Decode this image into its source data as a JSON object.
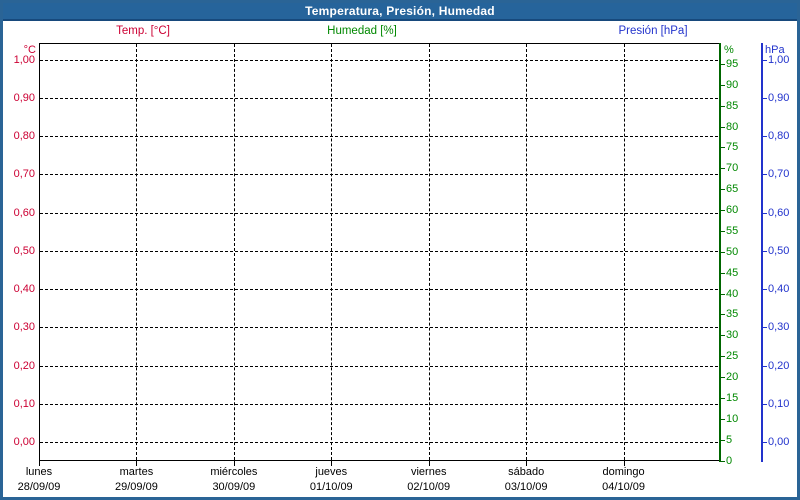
{
  "window": {
    "title": "Temperatura, Presión, Humedad"
  },
  "legend": [
    {
      "label": "Temp. [°C]",
      "color": "#cc0033"
    },
    {
      "label": "Humedad [%]",
      "color": "#008800"
    },
    {
      "label": "Presión [hPa]",
      "color": "#2233cc"
    }
  ],
  "chart_data": {
    "type": "line",
    "title": "Temperatura, Presión, Humedad",
    "series": [
      {
        "name": "Temp. [°C]",
        "axis": "left",
        "color": "#cc0033",
        "points": []
      },
      {
        "name": "Humedad [%]",
        "axis": "right_inner",
        "color": "#008800",
        "points": []
      },
      {
        "name": "Presión [hPa]",
        "axis": "right_outer",
        "color": "#2233cc",
        "points": []
      }
    ],
    "legend_position": "top",
    "grid": {
      "horizontal": "dashed black at every 0.10 of left axis",
      "vertical": "dashed black at each day boundary"
    },
    "axes": {
      "left": {
        "unit": "°C",
        "color": "#cc0033",
        "min": 0.0,
        "max": 1.0,
        "step": 0.1,
        "tick_labels": [
          "1,00",
          "0,90",
          "0,80",
          "0,70",
          "0,60",
          "0,50",
          "0,40",
          "0,30",
          "0,20",
          "0,10",
          "0,00"
        ]
      },
      "right_inner": {
        "unit": "%",
        "color": "#008800",
        "axis_color": "#006600",
        "min": 0,
        "max": 100,
        "step": 5,
        "tick_labels": [
          "95",
          "90",
          "85",
          "80",
          "75",
          "70",
          "65",
          "60",
          "55",
          "50",
          "45",
          "40",
          "35",
          "30",
          "25",
          "20",
          "15",
          "10",
          "5",
          "0"
        ]
      },
      "right_outer": {
        "unit": "hPa",
        "color": "#2233cc",
        "min": 0.0,
        "max": 1.0,
        "step": 0.1,
        "tick_labels": [
          "1,00",
          "0,90",
          "0,80",
          "0,70",
          "0,60",
          "0,50",
          "0,40",
          "0,30",
          "0,20",
          "0,10",
          "0,00"
        ]
      },
      "x": {
        "days": [
          {
            "name": "lunes",
            "date": "28/09/09"
          },
          {
            "name": "martes",
            "date": "29/09/09"
          },
          {
            "name": "miércoles",
            "date": "30/09/09"
          },
          {
            "name": "jueves",
            "date": "01/10/09"
          },
          {
            "name": "viernes",
            "date": "02/10/09"
          },
          {
            "name": "sábado",
            "date": "03/10/09"
          },
          {
            "name": "domingo",
            "date": "04/10/09"
          }
        ]
      }
    }
  }
}
